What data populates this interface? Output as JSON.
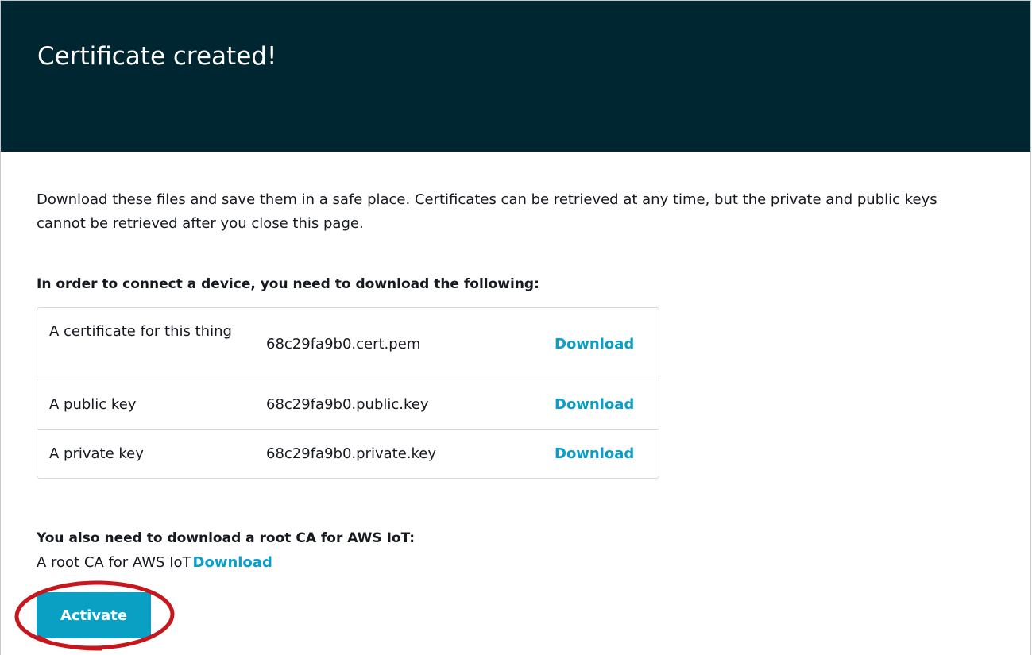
{
  "header": {
    "title": "Certificate created!"
  },
  "intro": {
    "text": "Download these files and save them in a safe place. Certificates can be retrieved at any time, but the private and public keys cannot be retrieved after you close this page."
  },
  "device_section": {
    "heading": "In order to connect a device, you need to download the following:",
    "rows": [
      {
        "description": "A certificate for this thing",
        "filename": "68c29fa9b0.cert.pem",
        "action": "Download"
      },
      {
        "description": "A public key",
        "filename": "68c29fa9b0.public.key",
        "action": "Download"
      },
      {
        "description": "A private key",
        "filename": "68c29fa9b0.private.key",
        "action": "Download"
      }
    ]
  },
  "rootca_section": {
    "heading": "You also need to download a root CA for AWS IoT:",
    "label": "A root CA for AWS IoT",
    "action": "Download"
  },
  "actions": {
    "activate_label": "Activate"
  },
  "colors": {
    "header_bg": "#002631",
    "link": "#0a9ec8",
    "button_bg": "#0aa0c4",
    "highlight_ring": "#c8161d"
  }
}
